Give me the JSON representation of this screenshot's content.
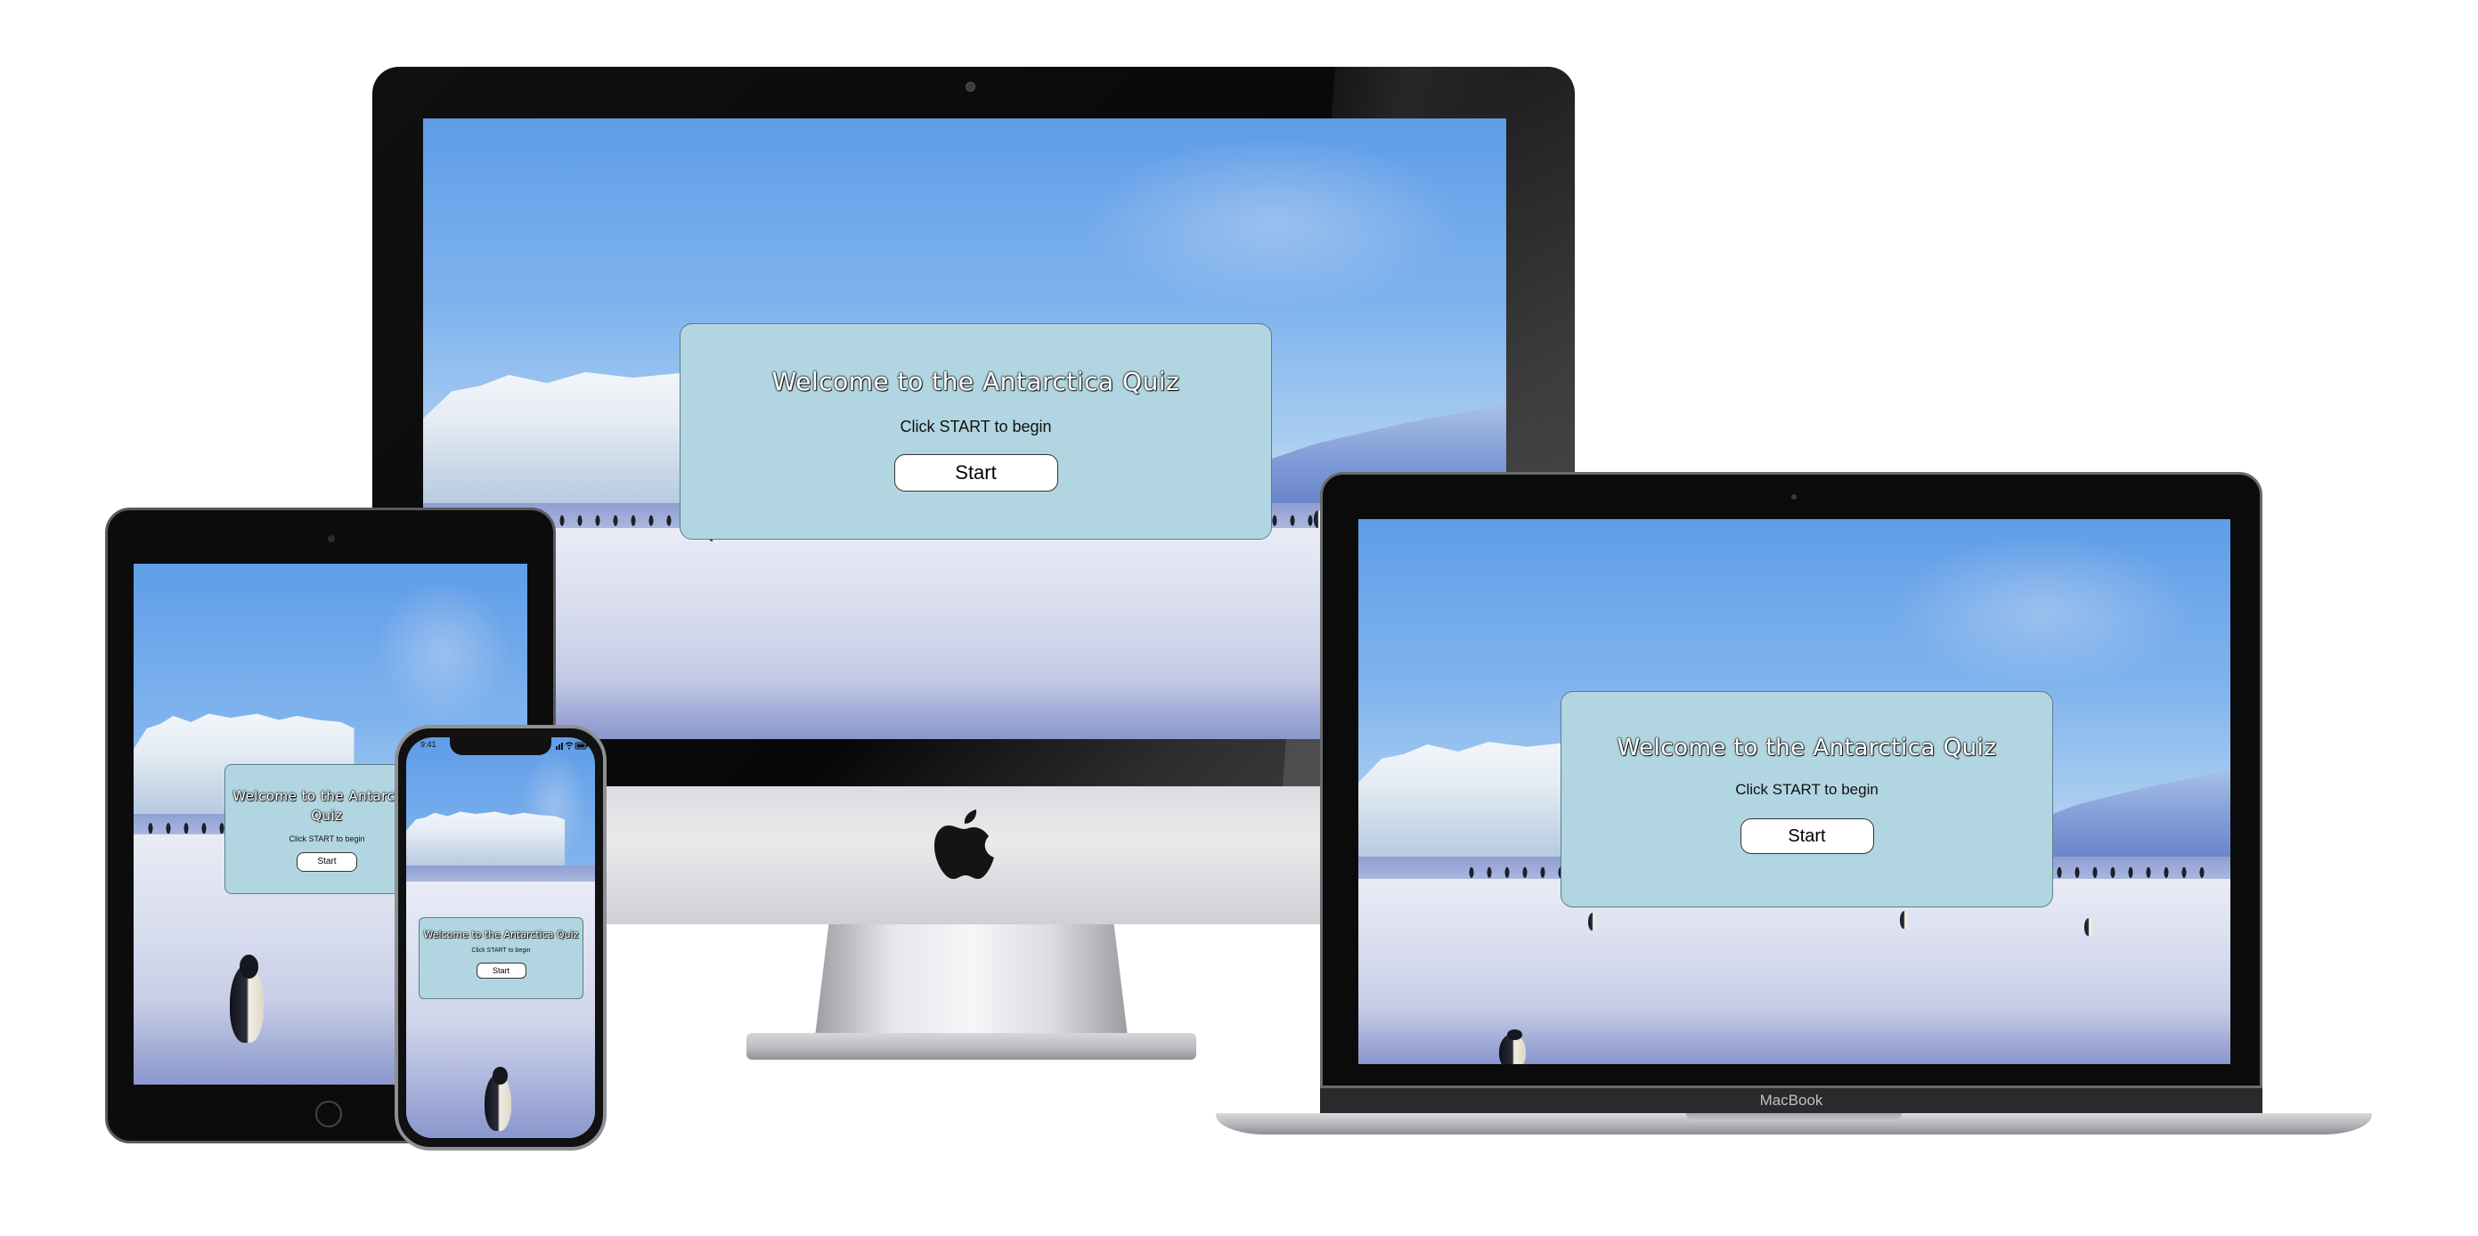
{
  "quiz": {
    "title": "Welcome to the Antarctica Quiz",
    "title_line1": "Welcome to the Antarctica",
    "title_line2": "Quiz",
    "subtitle": "Click START to begin",
    "start_label": "Start"
  },
  "devices": {
    "macbook_label": "MacBook",
    "iphone_time": "9:41"
  },
  "colors": {
    "card_bg": "#b2d6e1",
    "sky": "#5f9de8",
    "snow": "#d7dcee"
  },
  "icons": [
    "apple-logo-icon",
    "wifi-icon",
    "battery-icon",
    "signal-icon"
  ]
}
